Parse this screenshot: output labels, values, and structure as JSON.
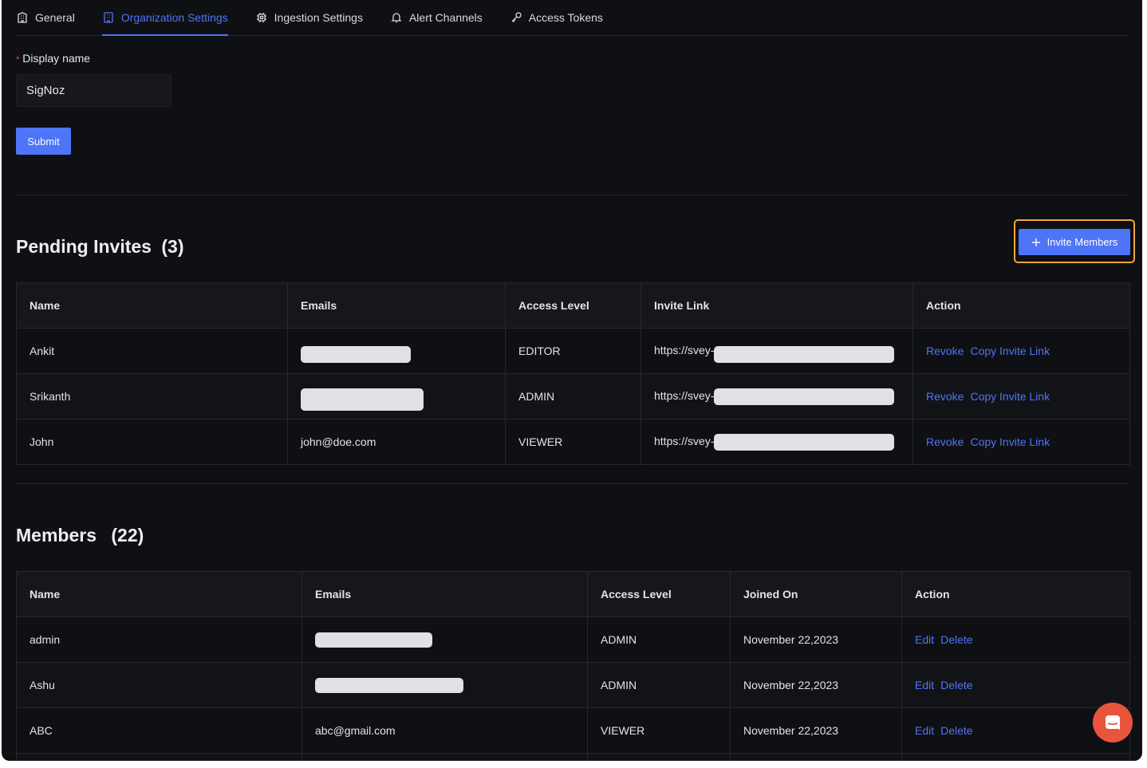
{
  "tabs": [
    {
      "label": "General",
      "icon": "building-icon"
    },
    {
      "label": "Organization Settings",
      "icon": "office-icon",
      "active": true
    },
    {
      "label": "Ingestion Settings",
      "icon": "chip-icon"
    },
    {
      "label": "Alert Channels",
      "icon": "bell-icon"
    },
    {
      "label": "Access Tokens",
      "icon": "key-icon"
    }
  ],
  "form": {
    "required_mark": "*",
    "display_name_label": "Display name",
    "display_name_value": "SigNoz",
    "submit_label": "Submit"
  },
  "pending": {
    "title": "Pending Invites",
    "count": "(3)",
    "invite_button": "Invite Members",
    "headers": [
      "Name",
      "Emails",
      "Access Level",
      "Invite Link",
      "Action"
    ],
    "rows": [
      {
        "name": "Ankit",
        "email": "",
        "access": "EDITOR",
        "link": "https://svey-",
        "revoke": "Revoke",
        "copy": "Copy Invite Link"
      },
      {
        "name": "Srikanth",
        "email": "",
        "access": "ADMIN",
        "link": "https://svey-",
        "revoke": "Revoke",
        "copy": "Copy Invite Link"
      },
      {
        "name": "John",
        "email": "john@doe.com",
        "access": "VIEWER",
        "link": "https://svey-",
        "revoke": "Revoke",
        "copy": "Copy Invite Link"
      }
    ]
  },
  "members": {
    "title": "Members",
    "count": "(22)",
    "headers": [
      "Name",
      "Emails",
      "Access Level",
      "Joined On",
      "Action"
    ],
    "rows": [
      {
        "name": "admin",
        "email": "",
        "access": "ADMIN",
        "joined": "November 22,2023",
        "edit": "Edit",
        "delete": "Delete"
      },
      {
        "name": "Ashu",
        "email": "",
        "access": "ADMIN",
        "joined": "November 22,2023",
        "edit": "Edit",
        "delete": "Delete"
      },
      {
        "name": "ABC",
        "email": "abc@gmail.com",
        "access": "VIEWER",
        "joined": "November 22,2023",
        "edit": "Edit",
        "delete": "Delete"
      }
    ]
  },
  "colors": {
    "accent": "#4e74f8",
    "background": "#0f1013",
    "highlight": "#f0a63a",
    "chat": "#e9553c"
  }
}
